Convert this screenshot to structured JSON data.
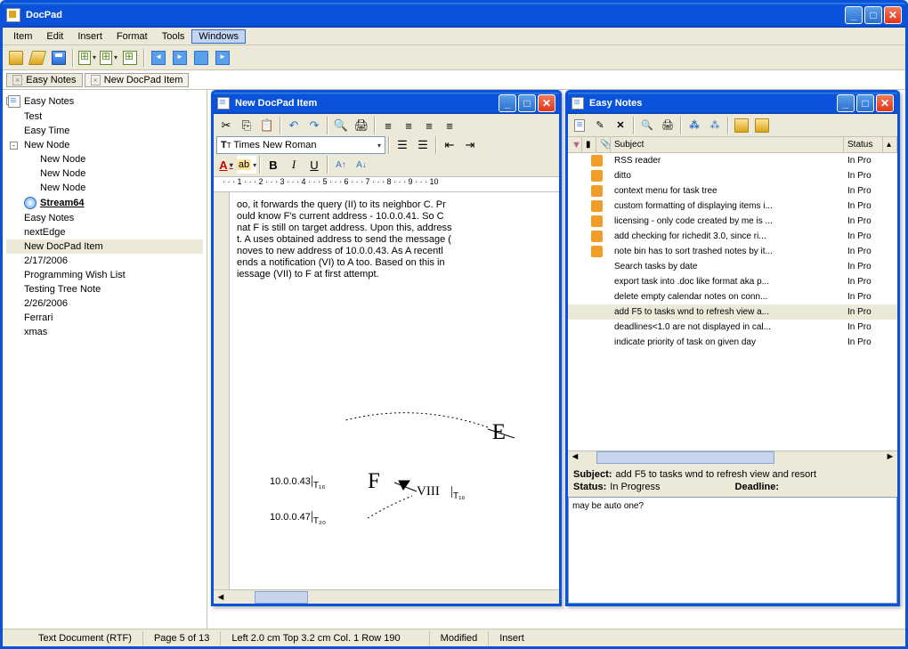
{
  "app": {
    "title": "DocPad"
  },
  "menu": [
    "Item",
    "Edit",
    "Insert",
    "Format",
    "Tools",
    "Windows"
  ],
  "tabs": [
    {
      "label": "Easy Notes",
      "active": false
    },
    {
      "label": "New DocPad Item",
      "active": true
    }
  ],
  "tree": [
    {
      "level": 0,
      "toggle": "+",
      "icon": "doc",
      "label": "Easy Notes"
    },
    {
      "level": 1,
      "label": "Test"
    },
    {
      "level": 1,
      "label": "Easy Time"
    },
    {
      "level": 1,
      "toggle": "-",
      "label": "New Node"
    },
    {
      "level": 2,
      "label": "New Node"
    },
    {
      "level": 2,
      "label": "New Node"
    },
    {
      "level": 2,
      "label": "New Node"
    },
    {
      "level": 1,
      "icon": "circle",
      "label": "Stream64",
      "bold": true
    },
    {
      "level": 1,
      "label": "Easy Notes"
    },
    {
      "level": 1,
      "label": "nextEdge"
    },
    {
      "level": 1,
      "label": "New DocPad Item",
      "selected": true
    },
    {
      "level": 1,
      "label": "2/17/2006"
    },
    {
      "level": 1,
      "label": "Programming Wish List"
    },
    {
      "level": 1,
      "label": "Testing Tree Note"
    },
    {
      "level": 1,
      "label": "2/26/2006"
    },
    {
      "level": 1,
      "label": "Ferrari"
    },
    {
      "level": 1,
      "label": "xmas"
    }
  ],
  "editor_win": {
    "title": "New DocPad Item",
    "font": "Times New Roman",
    "ruler": " · · · 1 · · · 2 · · · 3 · · · 4 · · · 5 · · · 6 · · · 7 · · · 8 · · · 9 · · · 10",
    "body": [
      "oo, it forwards the query (II) to its neighbor C. Pr",
      "ould know F's current address - 10.0.0.41. So C",
      "nat F is still on target address. Upon this, address",
      "t. A uses obtained address to send the message (",
      "noves to new address of 10.0.0.43. As A recentl",
      "ends a notification (VI) to A too. Based on this in",
      "iessage (VII) to F at first attempt."
    ],
    "diagram": {
      "nodes": [
        "E",
        "F",
        "VIII"
      ],
      "ips": [
        {
          "ip": "10.0.0.43",
          "t": "T₁₆"
        },
        {
          "ip": "10.0.0.47",
          "t": "T₂₀"
        }
      ],
      "t_right": "T₁₆"
    }
  },
  "notes_win": {
    "title": "Easy Notes",
    "columns": {
      "subject": "Subject",
      "status": "Status"
    },
    "rows": [
      {
        "color": true,
        "subject": "RSS reader",
        "status": "In Pro"
      },
      {
        "color": true,
        "subject": "ditto",
        "status": "In Pro"
      },
      {
        "color": true,
        "subject": "context menu for task tree",
        "status": "In Pro"
      },
      {
        "color": true,
        "subject": "custom formatting of displaying items i...",
        "status": "In Pro"
      },
      {
        "color": true,
        "subject": "licensing - only code created by me is ...",
        "status": "In Pro"
      },
      {
        "color": true,
        "subject": "add checking for richedit 3.0, since ri...",
        "status": "In Pro"
      },
      {
        "color": true,
        "subject": "note bin has to sort trashed notes by it...",
        "status": "In Pro"
      },
      {
        "color": false,
        "subject": "Search tasks by date",
        "status": "In Pro"
      },
      {
        "color": false,
        "subject": "export task into .doc like format aka p...",
        "status": "In Pro"
      },
      {
        "color": false,
        "subject": "delete empty calendar notes on conn...",
        "status": "In Pro"
      },
      {
        "color": false,
        "subject": "add F5 to tasks wnd to refresh view a...",
        "status": "In Pro",
        "selected": true
      },
      {
        "color": false,
        "subject": "deadlines<1.0 are not displayed in cal...",
        "status": "In Pro"
      },
      {
        "color": false,
        "subject": "indicate priority of task on given day",
        "status": "In Pro"
      }
    ],
    "detail": {
      "subject_label": "Subject:",
      "subject": "add F5 to tasks wnd to refresh view and resort",
      "status_label": "Status:",
      "status": "In Progress",
      "deadline_label": "Deadline:",
      "deadline": "",
      "memo": "may be auto one?"
    },
    "scroll": {
      "v_present": true
    }
  },
  "status": {
    "doctype": "Text Document (RTF)",
    "page": "Page 5 of 13",
    "pos": "Left 2.0 cm  Top 3.2 cm  Col. 1  Row 190",
    "modified": "Modified",
    "insert": "Insert"
  }
}
